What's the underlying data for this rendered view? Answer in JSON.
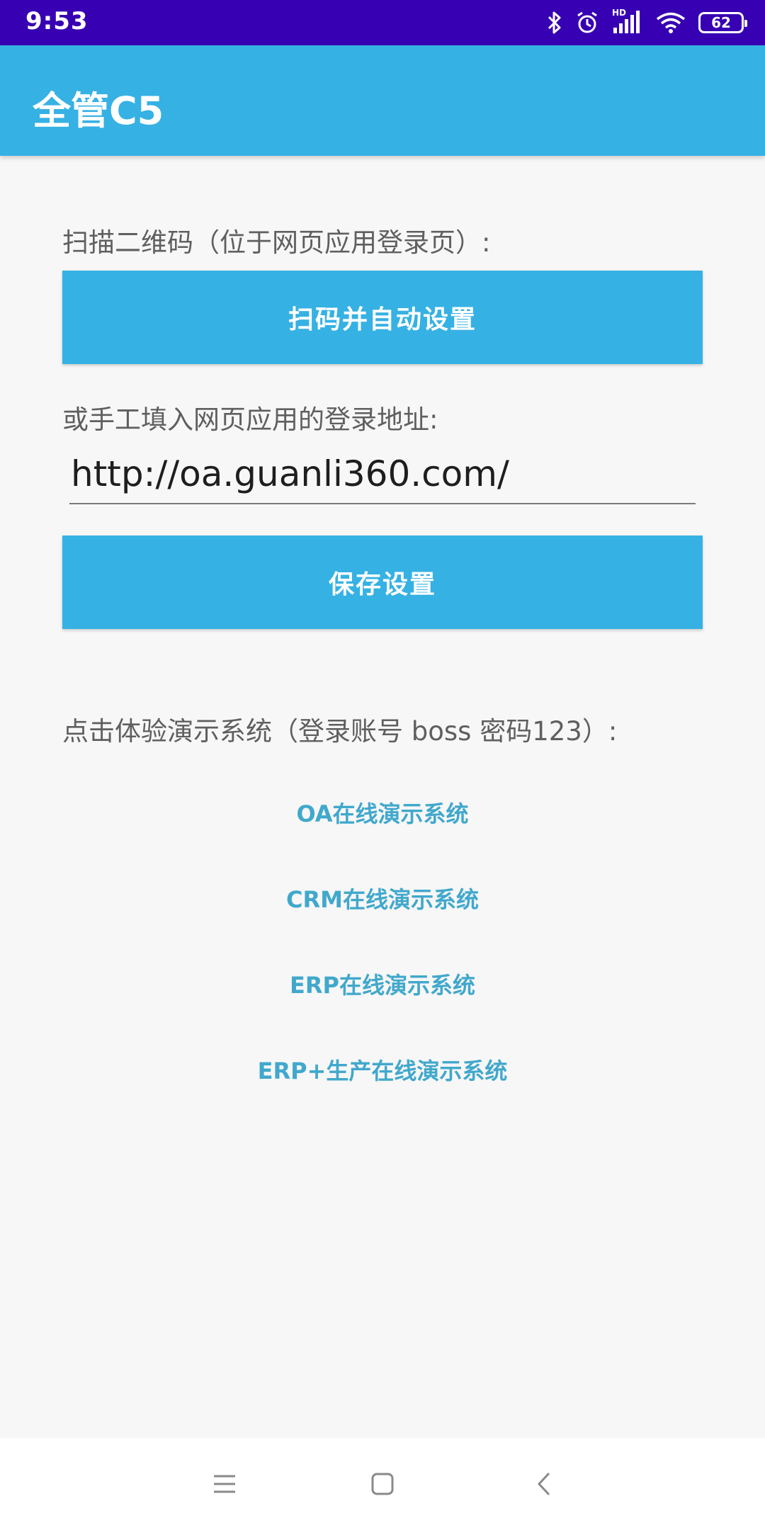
{
  "status_bar": {
    "time": "9:53",
    "icons": [
      "bluetooth-icon",
      "alarm-icon",
      "hd-signal-icon",
      "wifi-icon",
      "battery-icon"
    ],
    "battery_level": "62",
    "hd_label": "HD",
    "background_color": "#3700b3"
  },
  "app_bar": {
    "title": "全管C5",
    "background_color": "#36b1e3"
  },
  "scan": {
    "label": "扫描二维码（位于网页应用登录页）:",
    "button_label": "扫码并自动设置"
  },
  "manual": {
    "label": "或手工填入网页应用的登录地址:",
    "url_value": "http://oa.guanli360.com/",
    "save_button_label": "保存设置"
  },
  "demo": {
    "label": "点击体验演示系统（登录账号 boss 密码123）:",
    "links": [
      "OA在线演示系统",
      "CRM在线演示系统",
      "ERP在线演示系统",
      "ERP+生产在线演示系统"
    ],
    "link_color": "#41a8cc"
  },
  "nav_bar": {
    "icons": [
      "menu-icon",
      "home-icon",
      "back-icon"
    ]
  }
}
